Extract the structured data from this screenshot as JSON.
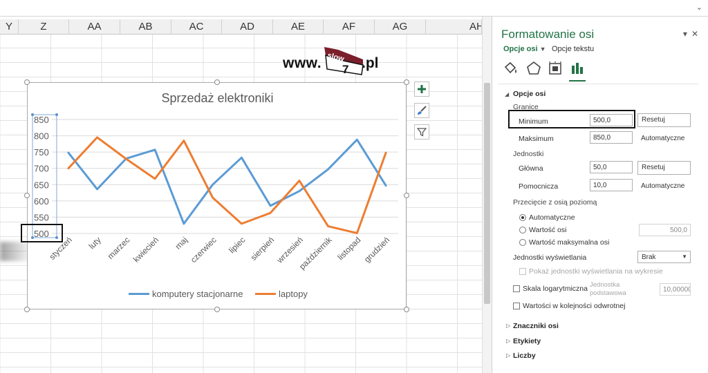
{
  "columns": [
    "Y",
    "Z",
    "AA",
    "AB",
    "AC",
    "AD",
    "AE",
    "AF",
    "AG",
    "AH"
  ],
  "logo": {
    "prefix": "www.",
    "badge_top": "slow",
    "badge_num": "7",
    "suffix": ".pl"
  },
  "chart_data": {
    "type": "line",
    "title": "Sprzedaż elektroniki",
    "categories": [
      "styczeń",
      "luty",
      "marzec",
      "kwiecień",
      "maj",
      "czerwiec",
      "lipiec",
      "sierpień",
      "wrzesień",
      "październik",
      "listopad",
      "grudzień"
    ],
    "series": [
      {
        "name": "komputery stacjonarne",
        "color": "#5B9BD5",
        "values": [
          748,
          636,
          730,
          757,
          530,
          650,
          733,
          585,
          630,
          697,
          788,
          647
        ]
      },
      {
        "name": "laptopy",
        "color": "#ED7D31",
        "values": [
          700,
          795,
          729,
          668,
          785,
          610,
          530,
          563,
          662,
          522,
          501,
          748
        ]
      }
    ],
    "ylim": [
      500,
      850
    ],
    "yticks": [
      "850",
      "800",
      "750",
      "700",
      "650",
      "600",
      "550",
      "500"
    ],
    "grid": true,
    "legend": "bottom"
  },
  "pane": {
    "title": "Formatowanie osi",
    "tab_axis": "Opcje osi",
    "tab_text": "Opcje tekstu",
    "section_axis": "Opcje osi",
    "bounds": "Granice",
    "min_label": "Minimum",
    "min_value": "500,0",
    "reset": "Resetuj",
    "max_label": "Maksimum",
    "max_value": "850,0",
    "auto": "Automatyczne",
    "units": "Jednostki",
    "major_label": "Główna",
    "major_value": "50,0",
    "minor_label": "Pomocnicza",
    "minor_value": "10,0",
    "crossing": "Przecięcie z osią poziomą",
    "opt_auto": "Automatyczne",
    "opt_value": "Wartość osi",
    "opt_value_box": "500,0",
    "opt_max": "Wartość maksymalna osi",
    "display_units": "Jednostki wyświetlania",
    "display_units_value": "Brak",
    "show_units": "Pokaż jednostki wyświetlania na wykresie",
    "log_scale": "Skala logarytmiczna",
    "base_label_1": "Jednostka",
    "base_label_2": "podstawowa",
    "base_value": "10,00000",
    "reverse": "Wartości w kolejności odwrotnej",
    "sec_ticks": "Znaczniki osi",
    "sec_labels": "Etykiety",
    "sec_numbers": "Liczby"
  }
}
